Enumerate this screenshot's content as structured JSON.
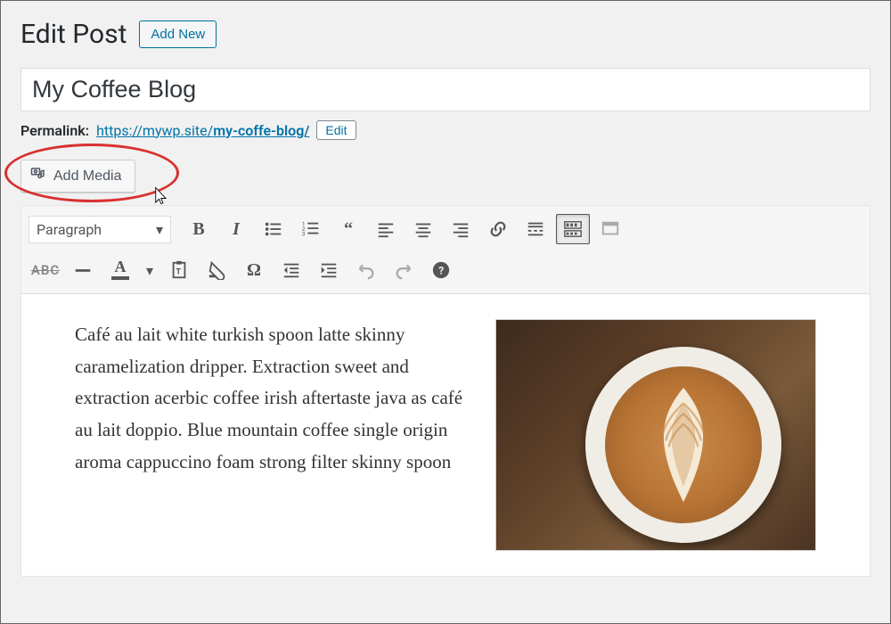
{
  "header": {
    "page_title": "Edit Post",
    "add_new_label": "Add New"
  },
  "title_field": {
    "value": "My Coffee Blog"
  },
  "permalink": {
    "label": "Permalink:",
    "base": "https://mywp.site/",
    "slug": "my-coffe-blog/",
    "edit_label": "Edit"
  },
  "media_button": {
    "label": "Add Media"
  },
  "toolbar": {
    "format_value": "Paragraph",
    "row1": {
      "bold": "B",
      "italic": "I"
    }
  },
  "content": {
    "body": "Café au lait white turkish spoon latte skinny caramelization dripper. Extraction sweet and extraction acerbic coffee irish aftertaste java as café au lait doppio. Blue mountain coffee single origin aroma cappuccino foam strong filter skinny spoon"
  }
}
